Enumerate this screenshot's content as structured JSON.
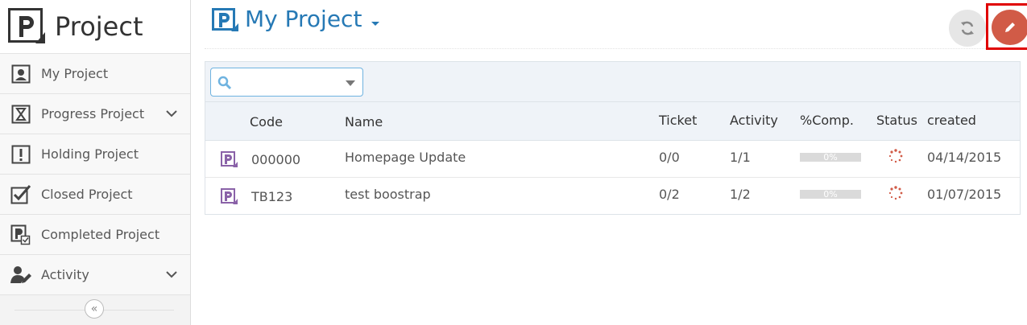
{
  "brand": {
    "title": "Project"
  },
  "sidebar": {
    "items": [
      {
        "label": "My Project",
        "icon": "user-square-icon"
      },
      {
        "label": "Progress Project",
        "icon": "hourglass-icon",
        "expandable": true
      },
      {
        "label": "Holding Project",
        "icon": "exclamation-square-icon"
      },
      {
        "label": "Closed Project",
        "icon": "check-square-icon"
      },
      {
        "label": "Completed Project",
        "icon": "project-check-icon"
      },
      {
        "label": "Activity",
        "icon": "user-edit-icon",
        "expandable": true
      }
    ],
    "collapse_label": "«"
  },
  "header": {
    "title": "My Project"
  },
  "search": {
    "placeholder": "",
    "value": ""
  },
  "table": {
    "columns": [
      "Code",
      "Name",
      "Ticket",
      "Activity",
      "%Comp.",
      "Status",
      "created"
    ],
    "rows": [
      {
        "code": "000000",
        "name": "Homepage Update",
        "ticket": "0/0",
        "activity": "1/1",
        "comp": "0%",
        "progress": 0,
        "created": "04/14/2015"
      },
      {
        "code": "TB123",
        "name": "test boostrap",
        "ticket": "0/2",
        "activity": "1/2",
        "comp": "0%",
        "progress": 0,
        "created": "01/07/2015"
      }
    ]
  },
  "colors": {
    "accent": "#2679b5",
    "edit": "#d15b47",
    "highlight": "#e00000",
    "project_icon": "#8a62a8",
    "status": "#d15b47"
  }
}
